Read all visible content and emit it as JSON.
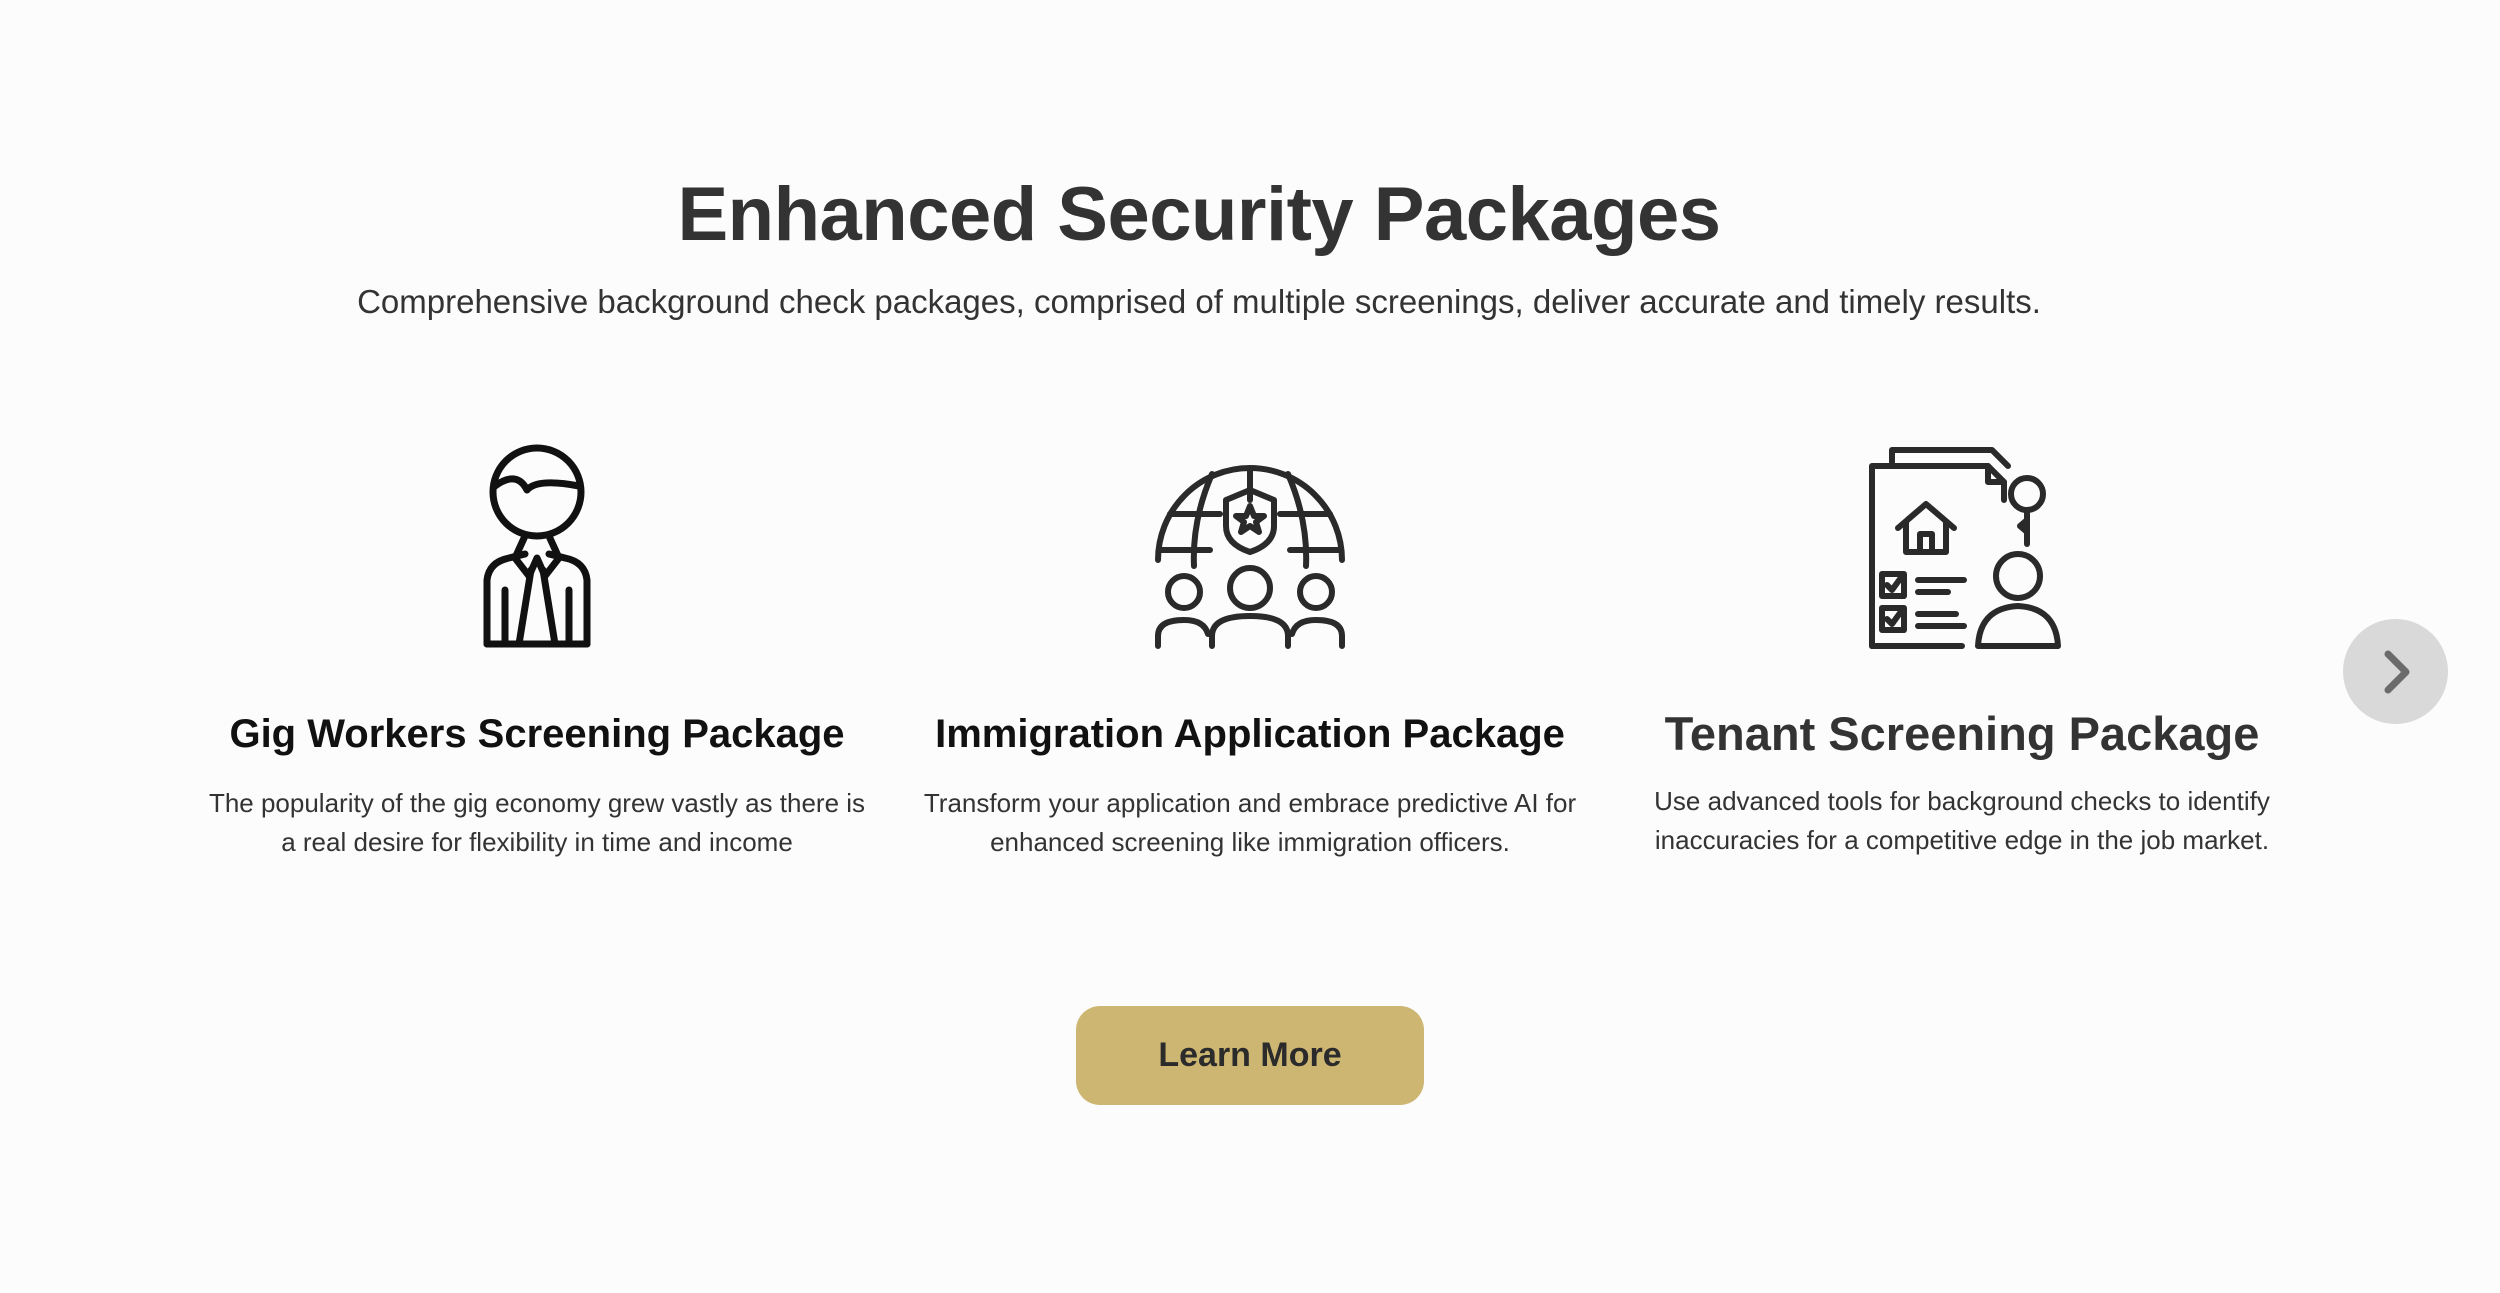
{
  "section": {
    "title": "Enhanced Security Packages",
    "subtitle": "Comprehensive background check packages, comprised of multiple screenings, deliver accurate and timely results."
  },
  "cards": [
    {
      "icon": "businessman-icon",
      "title": "Gig Workers Screening Package",
      "description": "The popularity of the gig economy grew vastly as there is a real desire for flexibility in time and income"
    },
    {
      "icon": "globe-people-badge-icon",
      "title": "Immigration Application Package",
      "description": "Transform your application and embrace predictive AI for enhanced screening like immigration officers."
    },
    {
      "icon": "tenant-document-key-icon",
      "title": "Tenant Screening Package",
      "description": "Use advanced tools for background checks to identify inaccuracies for a competitive edge in the job market."
    }
  ],
  "carousel": {
    "next_icon": "chevron-right-icon"
  },
  "cta": {
    "label": "Learn More"
  },
  "colors": {
    "background": "#fcfcfc",
    "accent": "#cdb572",
    "text": "#333333",
    "arrow_bg": "#d9d9d9"
  }
}
